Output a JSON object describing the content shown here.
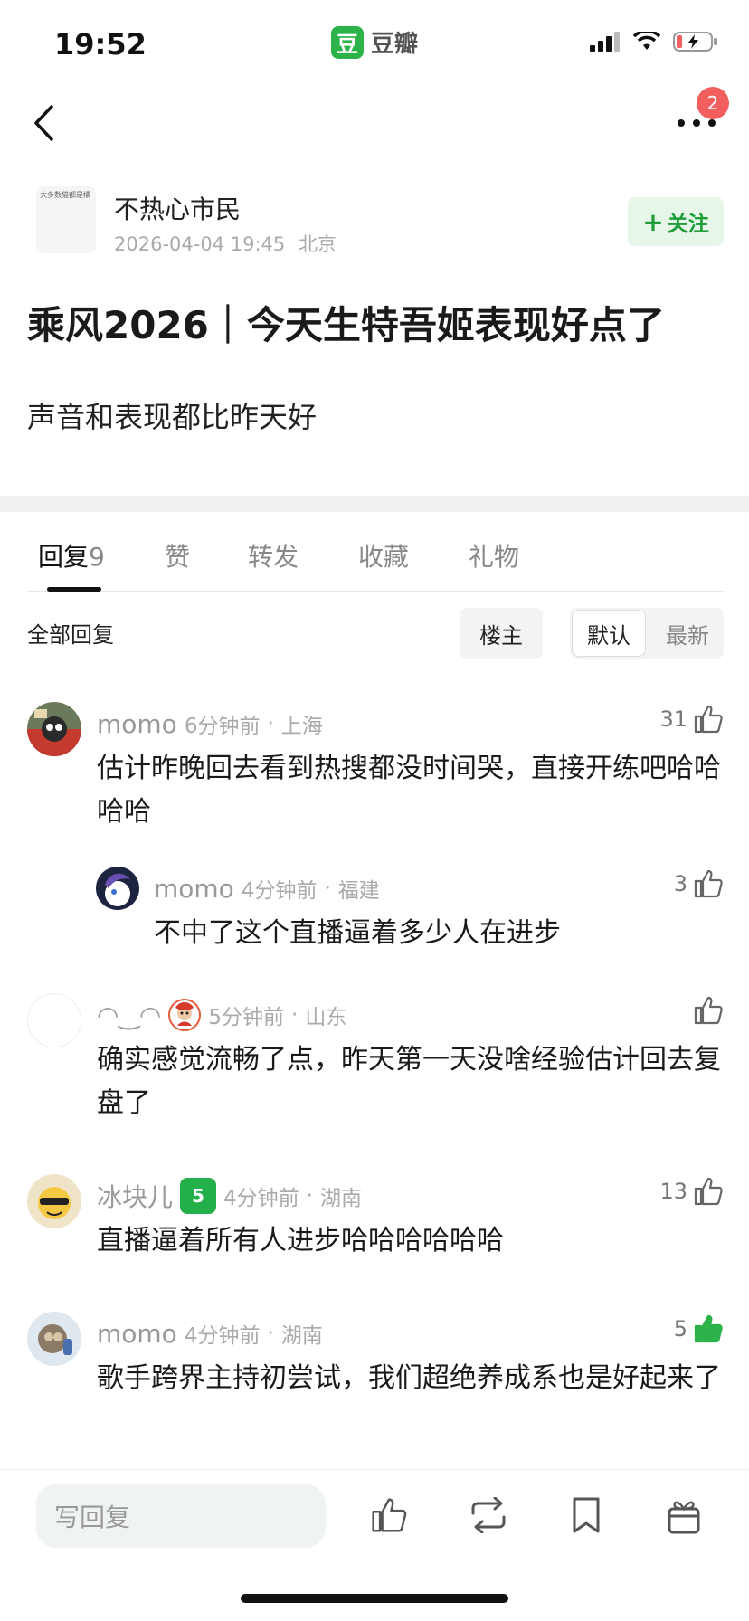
{
  "status_bar": {
    "time": "19:52",
    "app_logo_char": "豆",
    "app_name": "豆瓣"
  },
  "nav": {
    "notification_count": "2"
  },
  "author": {
    "name": "不热心市民",
    "date": "2026-04-04 19:45",
    "location": "北京",
    "avatar_text": "大多数猫都是橘",
    "follow_label": "关注",
    "follow_plus": "+"
  },
  "post": {
    "title": "乘风2026｜今天生特吾姬表现好点了",
    "body": "声音和表现都比昨天好"
  },
  "tabs": {
    "reply_label": "回复",
    "reply_count": "9",
    "likes_label": "赞",
    "reshare_label": "转发",
    "collect_label": "收藏",
    "gift_label": "礼物"
  },
  "filter": {
    "all_label": "全部回复",
    "owner_label": "楼主",
    "default_label": "默认",
    "latest_label": "最新"
  },
  "comments": [
    {
      "name": "momo",
      "time": "6分钟前",
      "location": "上海",
      "likes": "31",
      "text": "估计昨晚回去看到热搜都没时间哭，直接开练吧哈哈哈哈",
      "liked": false
    },
    {
      "name": "momo",
      "time": "4分钟前",
      "location": "福建",
      "likes": "3",
      "text": "不中了这个直播逼着多少人在进步",
      "liked": false
    },
    {
      "name": "◠‿◠",
      "time": "5分钟前",
      "location": "山东",
      "likes": "",
      "text": "确实感觉流畅了点，昨天第一天没啥经验估计回去复盘了",
      "liked": false
    },
    {
      "name": "冰块儿",
      "level": "5",
      "time": "4分钟前",
      "location": "湖南",
      "likes": "13",
      "text": "直播逼着所有人进步哈哈哈哈哈哈",
      "liked": false
    },
    {
      "name": "momo",
      "time": "4分钟前",
      "location": "湖南",
      "likes": "5",
      "text": "歌手跨界主持初尝试，我们超绝养成系也是好起来了",
      "liked": true
    }
  ],
  "meta_sep": "·",
  "bottom_bar": {
    "reply_placeholder": "写回复"
  },
  "colors": {
    "accent_green": "#1f9e3a",
    "badge_red": "#f35f5f",
    "liked_green": "#2bb34a"
  }
}
